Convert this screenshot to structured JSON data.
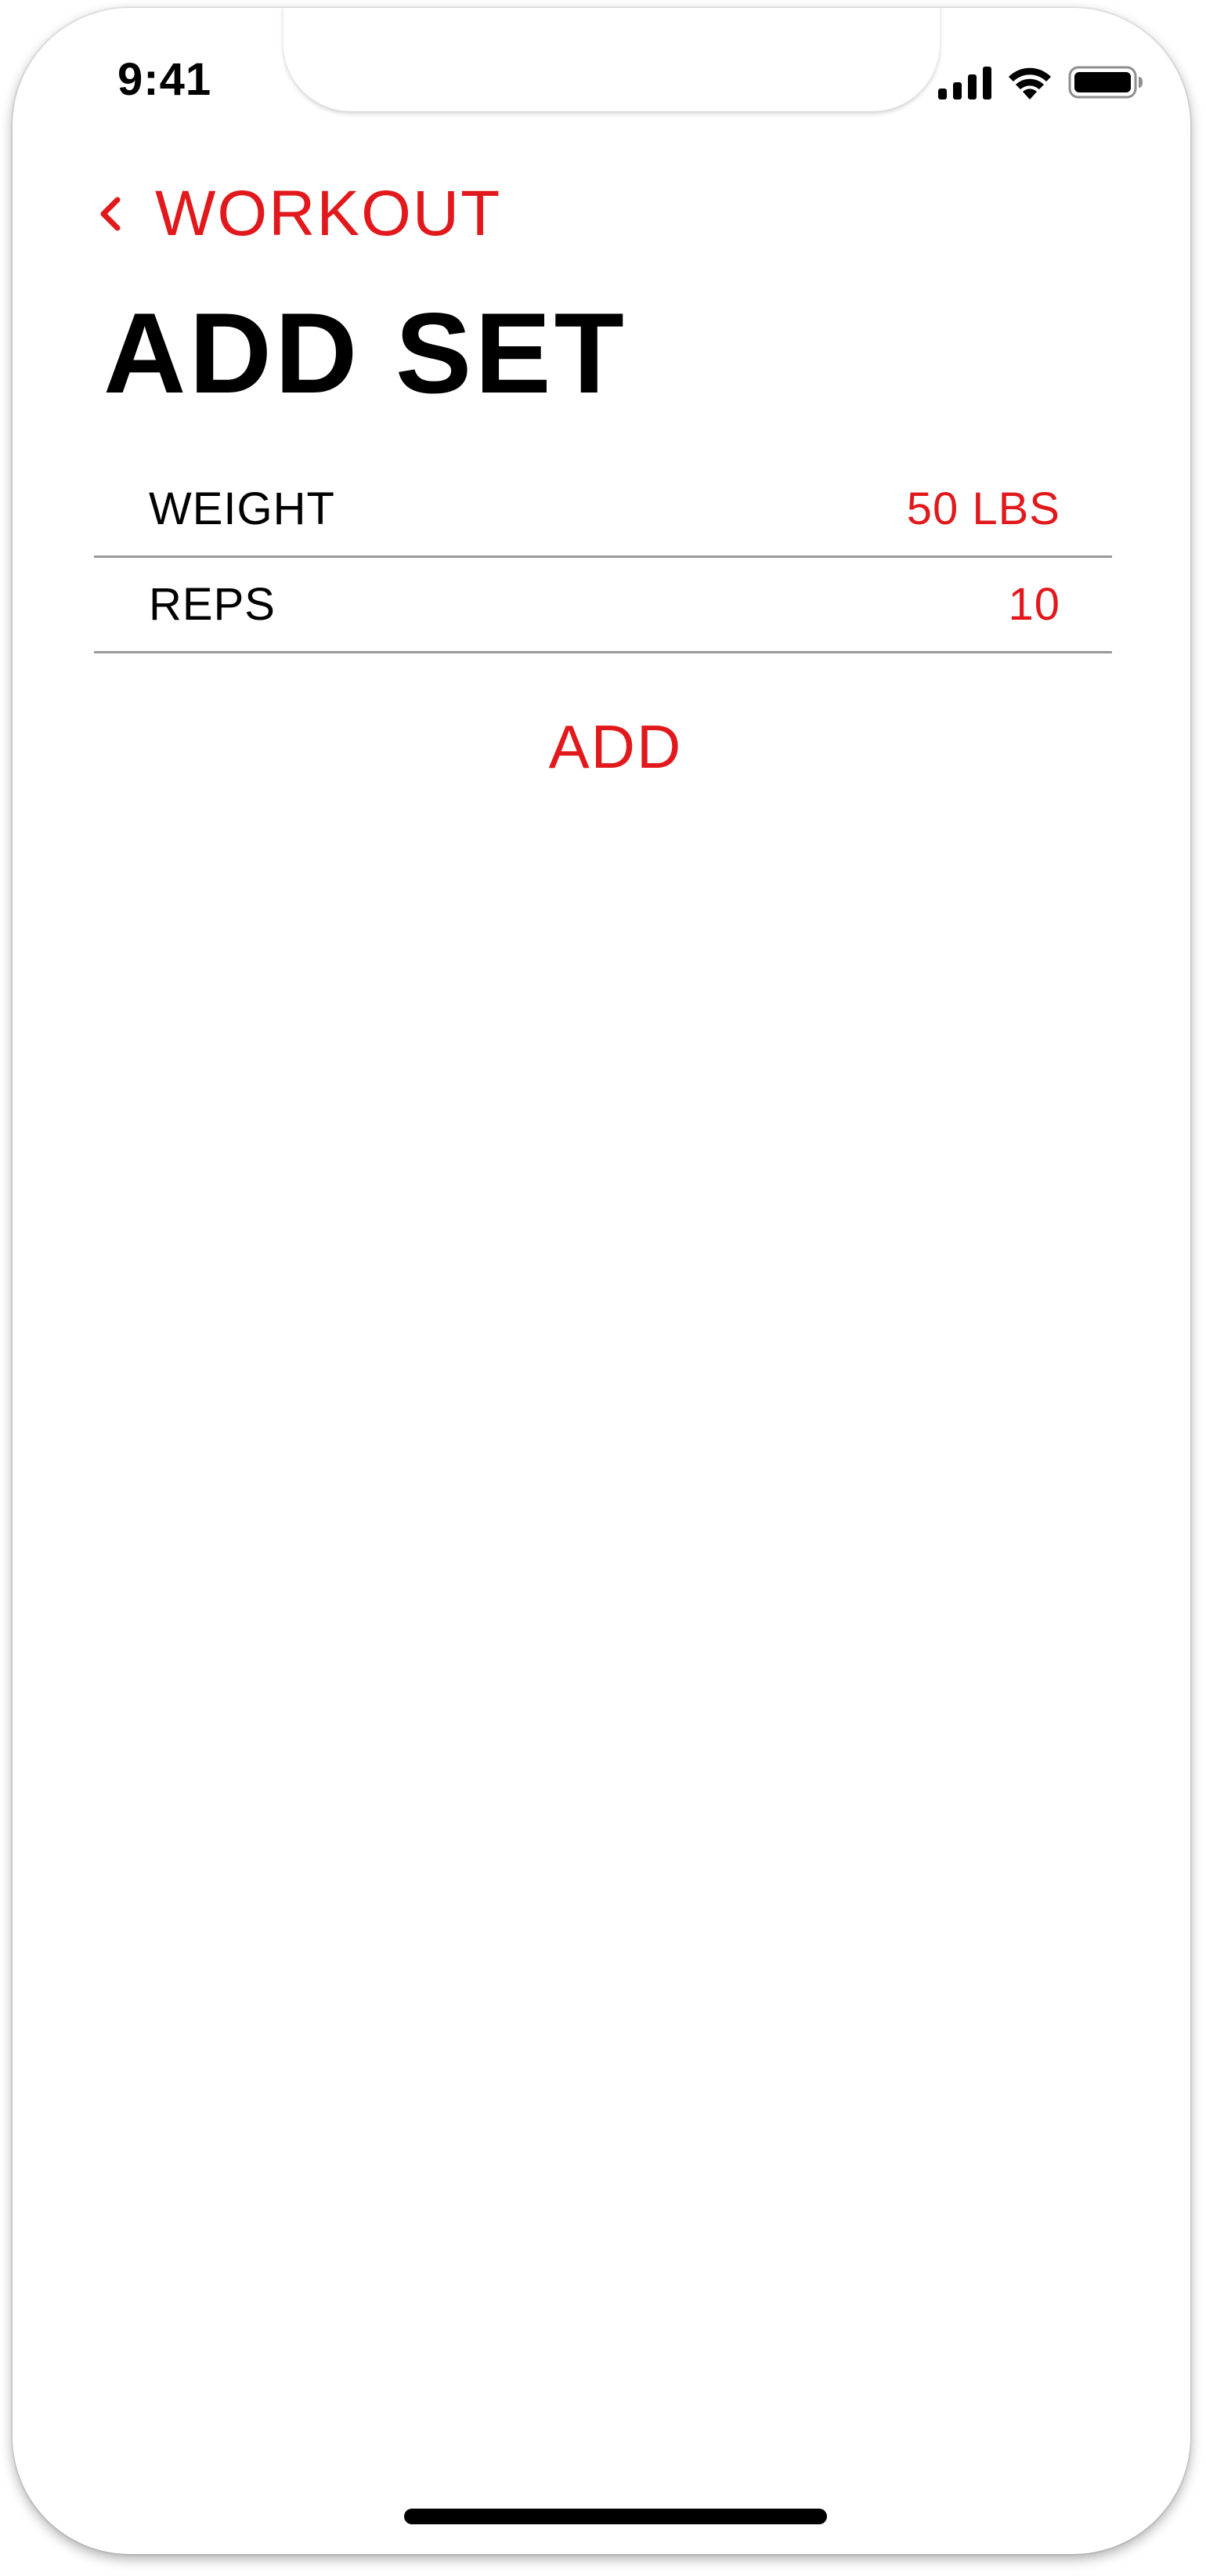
{
  "status_bar": {
    "time": "9:41",
    "icons": [
      "cellular-signal-icon",
      "wifi-icon",
      "battery-icon"
    ]
  },
  "nav": {
    "back_label": "WORKOUT",
    "back_icon": "chevron-left-icon"
  },
  "page": {
    "title": "ADD SET"
  },
  "form": {
    "rows": [
      {
        "label": "WEIGHT",
        "value": "50 LBS"
      },
      {
        "label": "REPS",
        "value": "10"
      }
    ]
  },
  "actions": {
    "add_label": "ADD"
  },
  "colors": {
    "accent": "#e2191c",
    "text": "#000000",
    "divider": "#9a9a9a",
    "background": "#ffffff"
  }
}
